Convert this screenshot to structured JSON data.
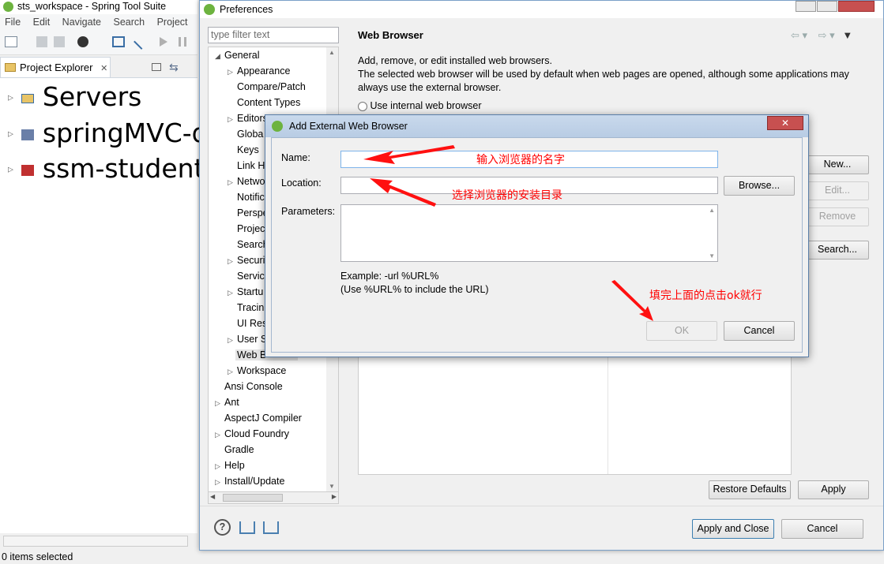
{
  "ide": {
    "title": "sts_workspace - Spring Tool Suite",
    "menu": [
      "File",
      "Edit",
      "Navigate",
      "Search",
      "Project"
    ],
    "explorer_tab": "Project Explorer",
    "projects": [
      "Servers",
      "springMVC-d",
      "ssm-studentI"
    ],
    "status": "0 items selected"
  },
  "prefs": {
    "title": "Preferences",
    "filter_placeholder": "type filter text",
    "tree": [
      {
        "label": "General",
        "level": 0,
        "expanded": true
      },
      {
        "label": "Appearance",
        "level": 1,
        "arrow": true
      },
      {
        "label": "Compare/Patch",
        "level": 1
      },
      {
        "label": "Content Types",
        "level": 1
      },
      {
        "label": "Editors",
        "level": 1,
        "arrow": true
      },
      {
        "label": "Globa",
        "level": 1
      },
      {
        "label": "Keys",
        "level": 1
      },
      {
        "label": "Link H",
        "level": 1
      },
      {
        "label": "Netwo",
        "level": 1,
        "arrow": true
      },
      {
        "label": "Notific",
        "level": 1
      },
      {
        "label": "Perspe",
        "level": 1
      },
      {
        "label": "Projec",
        "level": 1
      },
      {
        "label": "Search",
        "level": 1
      },
      {
        "label": "Securi",
        "level": 1,
        "arrow": true
      },
      {
        "label": "Servic",
        "level": 1
      },
      {
        "label": "Startu",
        "level": 1,
        "arrow": true
      },
      {
        "label": "Tracin",
        "level": 1
      },
      {
        "label": "UI Res",
        "level": 1
      },
      {
        "label": "User S",
        "level": 1,
        "arrow": true
      },
      {
        "label": "Web B",
        "level": 1,
        "selected": true
      },
      {
        "label": "Workspace",
        "level": 1,
        "arrow": true
      },
      {
        "label": "Ansi Console",
        "level": 0
      },
      {
        "label": "Ant",
        "level": 0,
        "arrow": true
      },
      {
        "label": "AspectJ Compiler",
        "level": 0
      },
      {
        "label": "Cloud Foundry",
        "level": 0,
        "arrow": true
      },
      {
        "label": "Gradle",
        "level": 0
      },
      {
        "label": "Help",
        "level": 0,
        "arrow": true
      },
      {
        "label": "Install/Update",
        "level": 0,
        "arrow": true
      }
    ],
    "page_title": "Web Browser",
    "description_line1": "Add, remove, or edit installed web browsers.",
    "description_line2": "The selected web browser will be used by default when web pages are opened, although some applications may always use the external browser.",
    "radio_internal": "Use internal web browser",
    "buttons": {
      "new": "New...",
      "edit": "Edit...",
      "remove": "Remove",
      "search": "Search...",
      "restore_defaults": "Restore Defaults",
      "apply": "Apply",
      "apply_close": "Apply and Close",
      "cancel": "Cancel"
    }
  },
  "dialog": {
    "title": "Add External Web Browser",
    "name_label": "Name:",
    "location_label": "Location:",
    "parameters_label": "Parameters:",
    "name_value": "",
    "location_value": "",
    "browse_button": "Browse...",
    "example_line1": "Example: -url %URL%",
    "example_line2": "(Use %URL% to include the URL)",
    "ok_button": "OK",
    "cancel_button": "Cancel"
  },
  "annotations": {
    "name_note": "输入浏览器的名字",
    "location_note": "选择浏览器的安装目录",
    "ok_note": "填完上面的点击ok就行"
  },
  "colors": {
    "annotation": "#ff0000",
    "accent_border": "#3c7fb1"
  }
}
